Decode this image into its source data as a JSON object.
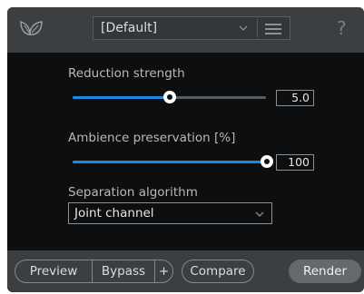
{
  "header": {
    "logo_icon": "leaf-logo-icon",
    "preset_value": "[Default]",
    "preset_dropdown_icon": "chevron-down-icon",
    "menu_icon": "hamburger-menu-icon",
    "help_label": "?"
  },
  "controls": {
    "reduction_strength": {
      "label": "Reduction strength",
      "value": "5.0",
      "slider_fraction": 0.5
    },
    "ambience_preservation": {
      "label": "Ambience preservation [%]",
      "value": "100",
      "slider_fraction": 1.0
    },
    "separation_algorithm": {
      "label": "Separation algorithm",
      "selected": "Joint channel",
      "dropdown_icon": "chevron-down-icon"
    }
  },
  "footer": {
    "preview": "Preview",
    "bypass": "Bypass",
    "plus": "+",
    "compare": "Compare",
    "render": "Render"
  },
  "colors": {
    "accent": "#1e88e5",
    "panel": "#0c0e10",
    "chrome": "#3c3f42"
  }
}
